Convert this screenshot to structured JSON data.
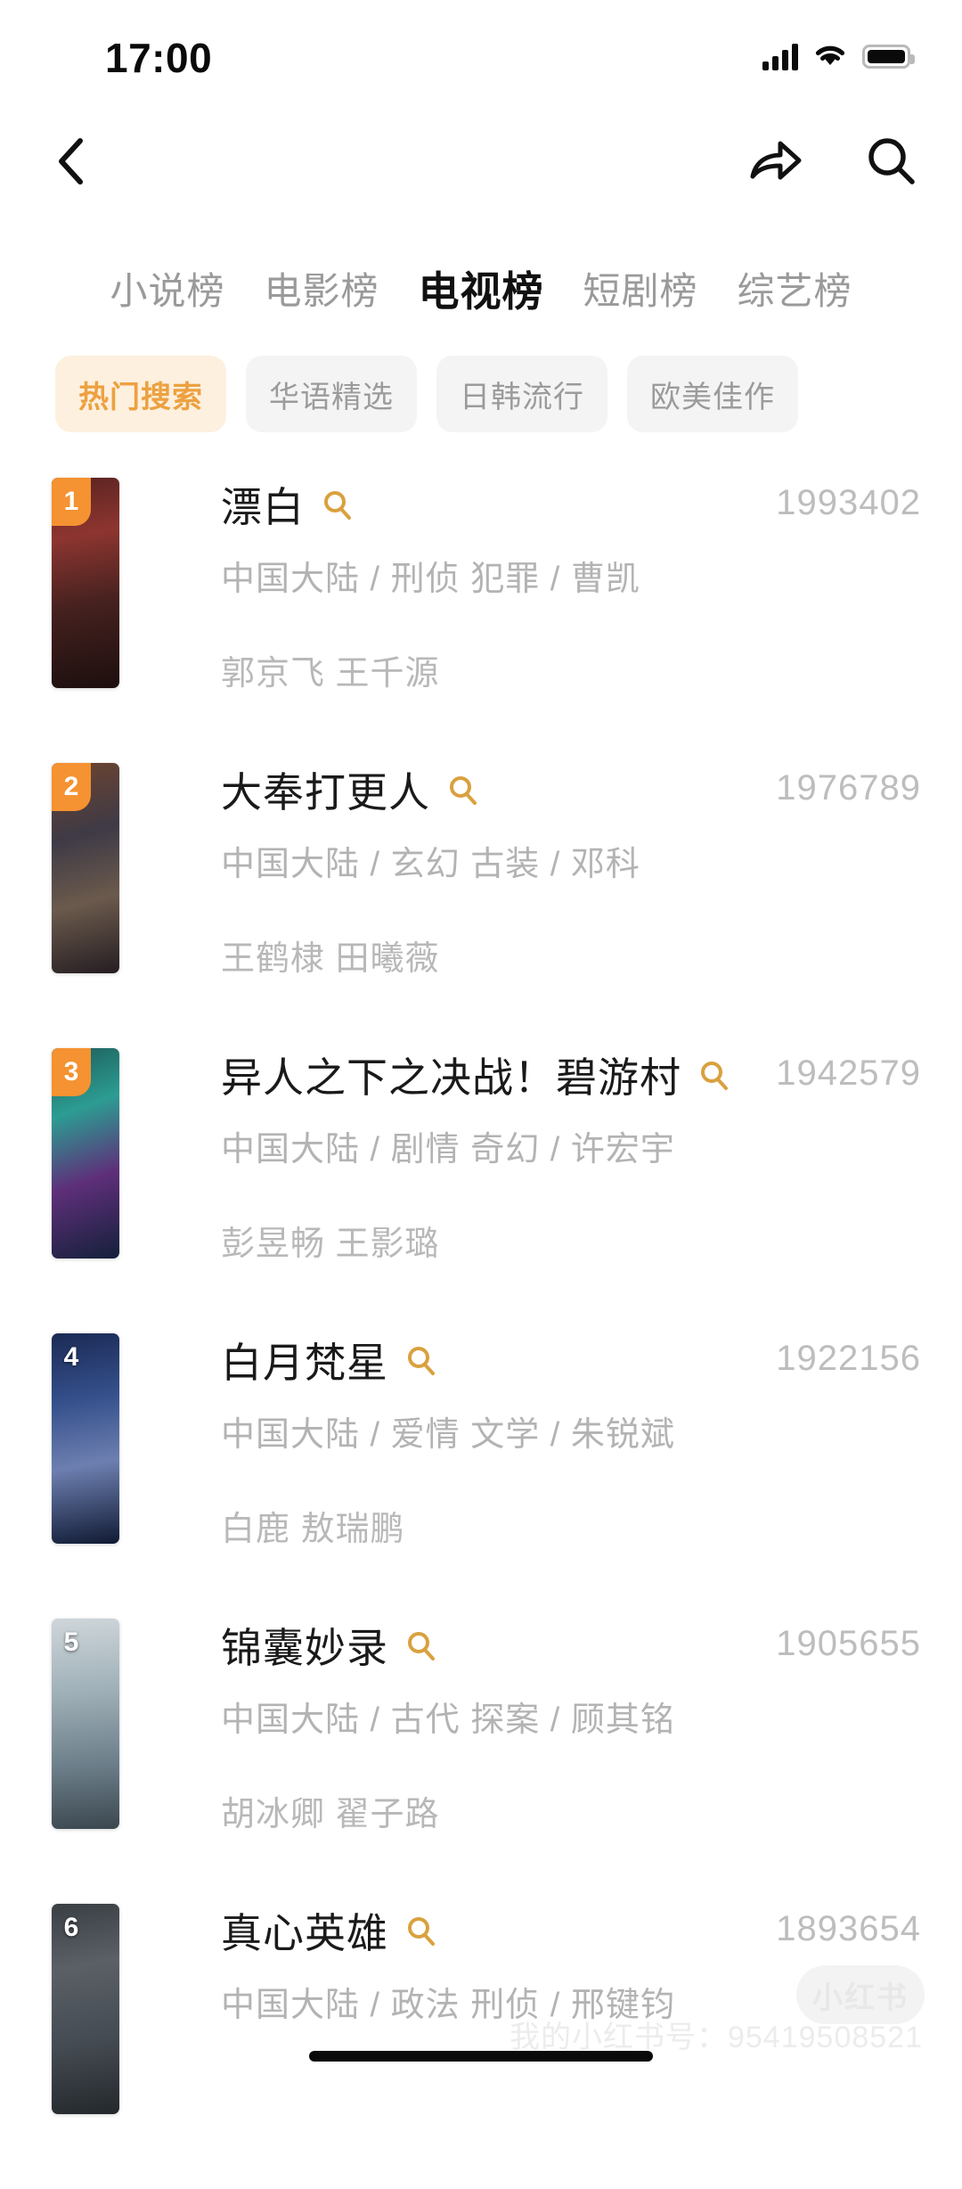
{
  "status_bar": {
    "time": "17:00",
    "signal_icon": "signal-bars-icon",
    "wifi_icon": "wifi-icon",
    "battery_icon": "battery-full-icon"
  },
  "navbar": {
    "back_icon": "chevron-left-icon",
    "share_icon": "share-arrow-icon",
    "search_icon": "search-icon"
  },
  "tabs": [
    {
      "label": "小说榜",
      "active": false
    },
    {
      "label": "电影榜",
      "active": false
    },
    {
      "label": "电视榜",
      "active": true
    },
    {
      "label": "短剧榜",
      "active": false
    },
    {
      "label": "综艺榜",
      "active": false
    }
  ],
  "chips": [
    {
      "label": "热门搜索",
      "active": true
    },
    {
      "label": "华语精选",
      "active": false
    },
    {
      "label": "日韩流行",
      "active": false
    },
    {
      "label": "欧美佳作",
      "active": false
    }
  ],
  "colors": {
    "accent_orange": "#f59231",
    "chip_active_bg": "#fdf0df",
    "chip_active_text": "#eda140",
    "title_search_icon": "#d9a13e",
    "muted_text": "#b3b3b3"
  },
  "list": [
    {
      "rank": "1",
      "rank_badge": true,
      "title": "漂白",
      "search_icon": "search-icon",
      "tags": "中国大陆 / 刑侦 犯罪 / 曹凯",
      "cast": "郭京飞 王千源",
      "count": "1993402",
      "poster_alt": "漂白"
    },
    {
      "rank": "2",
      "rank_badge": true,
      "title": "大奉打更人",
      "search_icon": "search-icon",
      "tags": "中国大陆 / 玄幻 古装 / 邓科",
      "cast": "王鹤棣 田曦薇",
      "count": "1976789",
      "poster_alt": "大奉打更人"
    },
    {
      "rank": "3",
      "rank_badge": true,
      "title": "异人之下之决战！碧游村",
      "search_icon": "search-icon",
      "tags": "中国大陆 / 剧情 奇幻 / 许宏宇",
      "cast": "彭昱畅 王影璐",
      "count": "1942579",
      "poster_alt": "异人之下之决战！碧游村"
    },
    {
      "rank": "4",
      "rank_badge": false,
      "title": "白月梵星",
      "search_icon": "search-icon",
      "tags": "中国大陆 / 爱情 文学 / 朱锐斌",
      "cast": "白鹿 敖瑞鹏",
      "count": "1922156",
      "poster_alt": "白月梵星"
    },
    {
      "rank": "5",
      "rank_badge": false,
      "title": "锦囊妙录",
      "search_icon": "search-icon",
      "tags": "中国大陆 / 古代 探案 / 顾其铭",
      "cast": "胡冰卿 翟子路",
      "count": "1905655",
      "poster_alt": "锦囊妙录"
    },
    {
      "rank": "6",
      "rank_badge": false,
      "title": "真心英雄",
      "search_icon": "search-icon",
      "tags": "中国大陆 / 政法 刑侦 / 邢键钧",
      "cast": "",
      "count": "1893654",
      "poster_alt": "真心英雄"
    }
  ],
  "watermark": {
    "logo": "小红书",
    "text": "我的小红书号：95419508521"
  }
}
